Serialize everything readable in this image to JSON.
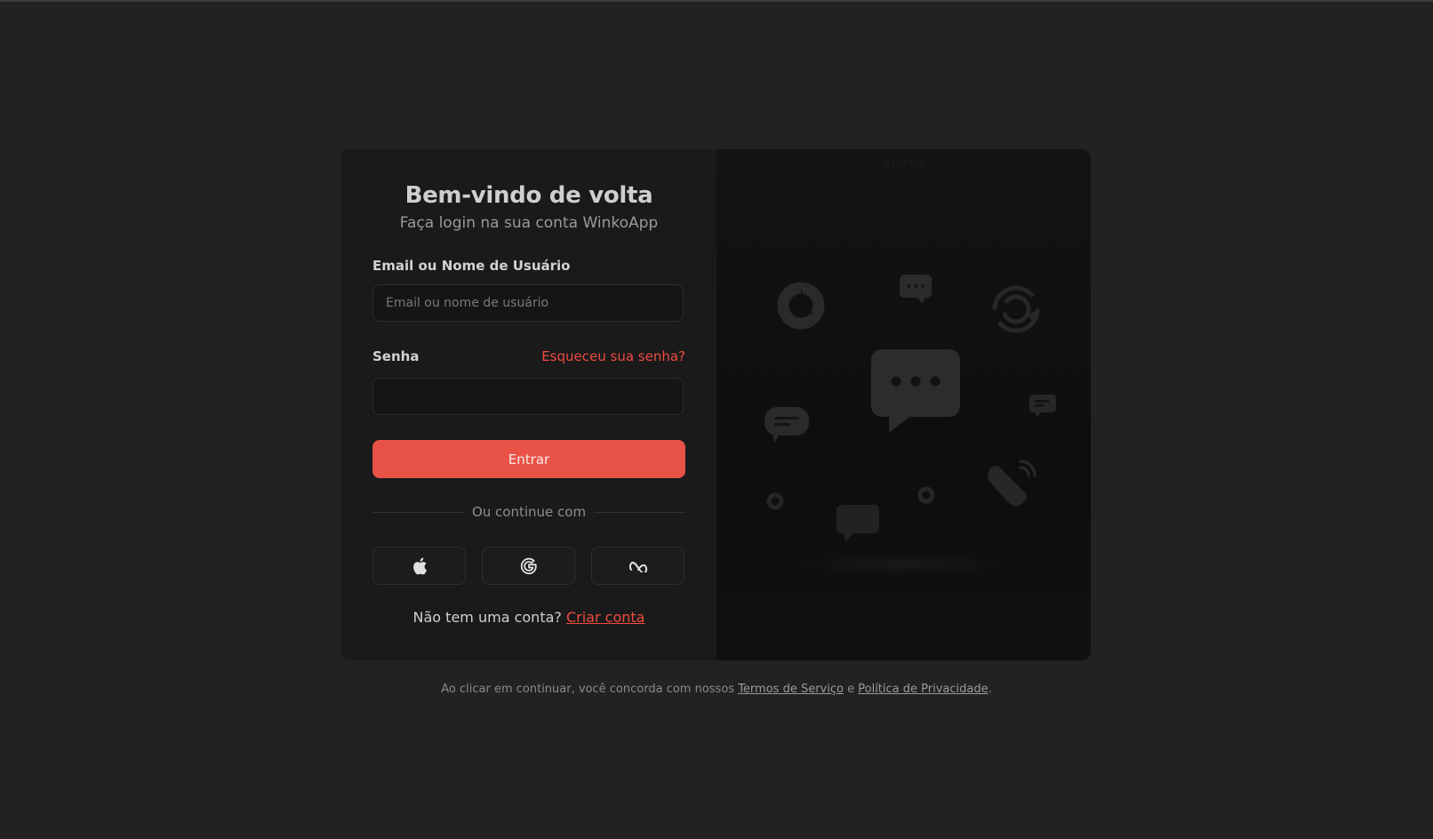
{
  "login": {
    "title": "Bem-vindo de volta",
    "subtitle": "Faça login na sua conta WinkoApp",
    "email_label": "Email ou Nome de Usuário",
    "email_placeholder": "Email ou nome de usuário",
    "email_value": "",
    "password_label": "Senha",
    "password_value": "",
    "forgot_link": "Esqueceu sua senha?",
    "submit_label": "Entrar",
    "divider_text": "Ou continue com",
    "social": [
      {
        "name": "apple",
        "icon": "apple-icon"
      },
      {
        "name": "google",
        "icon": "google-icon"
      },
      {
        "name": "meta",
        "icon": "meta-icon"
      }
    ],
    "signup_prompt": "Não tem uma conta?",
    "signup_link": "Criar conta"
  },
  "illustration": {
    "watermark": "#101010",
    "icons": [
      "donut-icon",
      "chat-bubble-dots-icon",
      "sync-icon",
      "chat-bubble-lines-icon",
      "phone-icon",
      "chat-bubble-icon"
    ]
  },
  "footer": {
    "prefix": "Ao clicar em continuar, você concorda com nossos",
    "terms": "Termos de Serviço",
    "conjunction": "e",
    "privacy": "Política de Privacidade",
    "suffix": "."
  },
  "colors": {
    "accent": "#e85247",
    "link": "#ef4b40",
    "background": "#222222",
    "card": "#1a1a1a",
    "panel": "#111111"
  }
}
